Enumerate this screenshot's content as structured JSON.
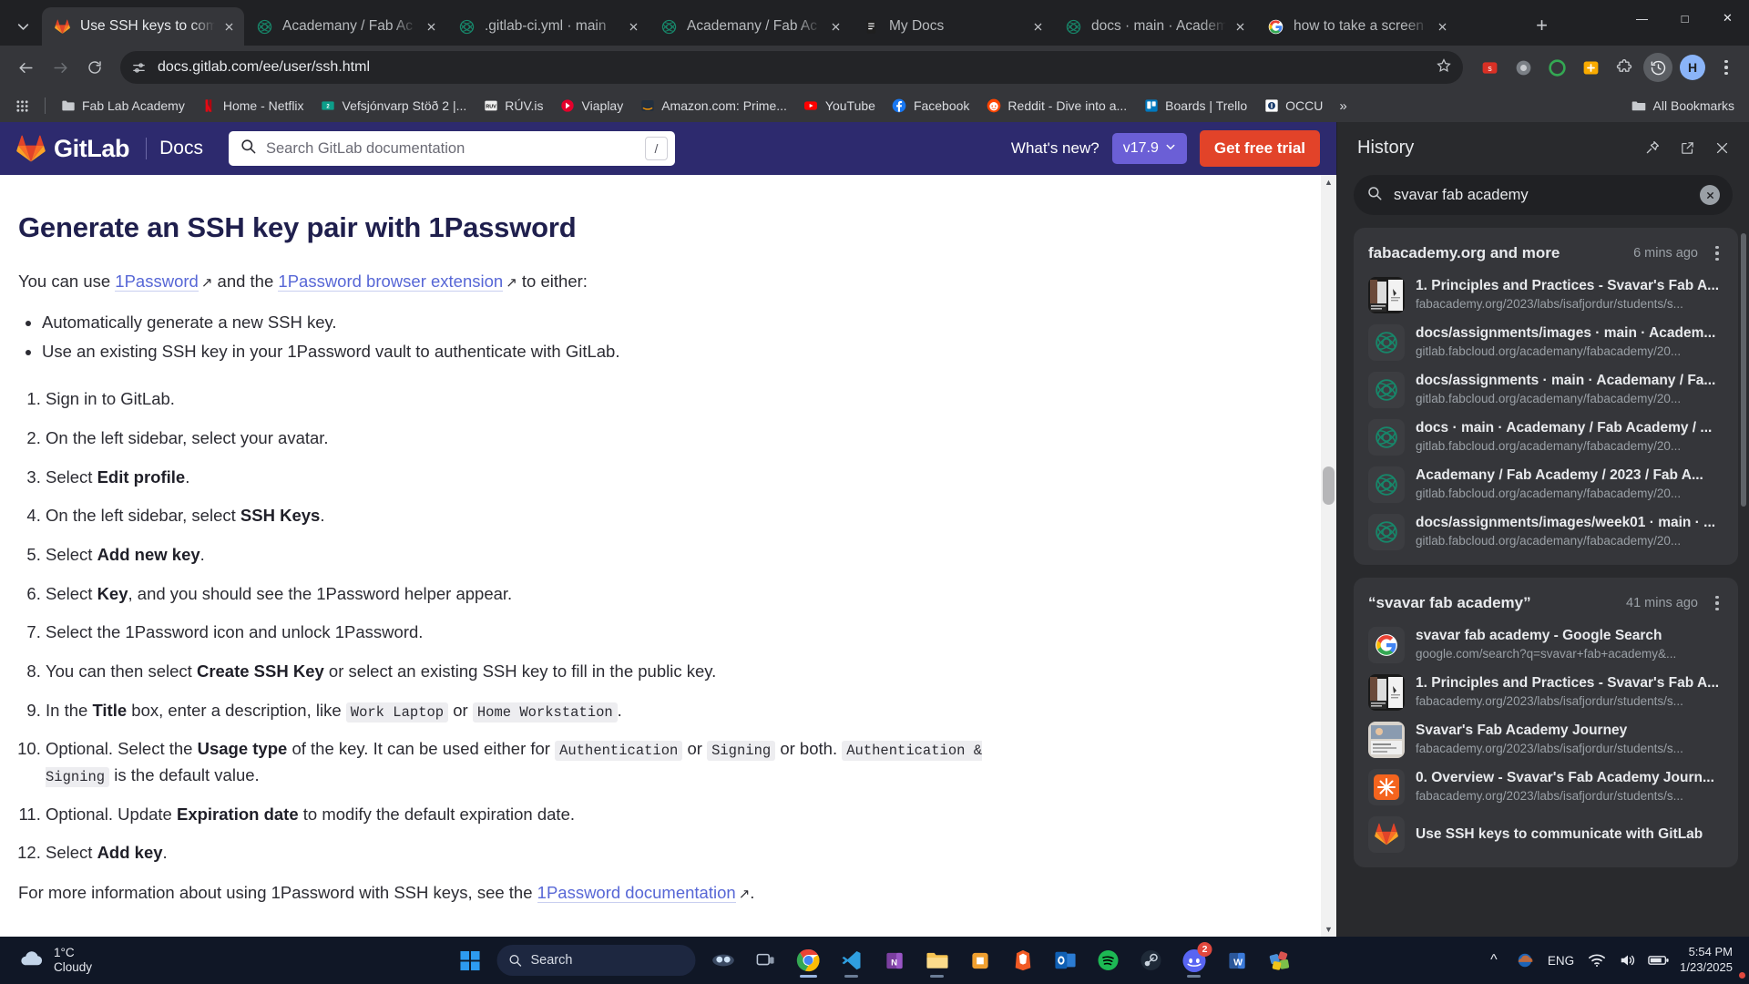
{
  "browser": {
    "tabs": [
      {
        "title": "Use SSH keys to com",
        "favicon": "gitlab-icon",
        "active": true
      },
      {
        "title": "Academany / Fab Ac",
        "favicon": "fabacademy-icon",
        "active": false
      },
      {
        "title": ".gitlab-ci.yml · main",
        "favicon": "fabacademy-icon",
        "active": false
      },
      {
        "title": "Academany / Fab Ac",
        "favicon": "fabacademy-icon",
        "active": false
      },
      {
        "title": "My Docs",
        "favicon": "docs-icon",
        "active": false
      },
      {
        "title": "docs · main · Academ",
        "favicon": "fabacademy-icon",
        "active": false
      },
      {
        "title": "how to take a screen",
        "favicon": "google-icon",
        "active": false
      }
    ],
    "new_tab_label": "+",
    "window_controls": {
      "minimize": "—",
      "maximize": "□",
      "close": "✕"
    },
    "omnibox": {
      "url": "docs.gitlab.com/ee/user/ssh.html",
      "site_icon": "tune-icon",
      "star_icon": "star-icon"
    },
    "profile_initial": "H",
    "bookmarks": [
      {
        "label": "Fab Lab Academy",
        "icon": "folder-icon"
      },
      {
        "label": "Home - Netflix",
        "icon": "netflix-icon"
      },
      {
        "label": "Vefsjónvarp Stöð 2 |...",
        "icon": "stod2-icon"
      },
      {
        "label": "RÚV.is",
        "icon": "ruv-icon"
      },
      {
        "label": "Viaplay",
        "icon": "viaplay-icon"
      },
      {
        "label": "Amazon.com: Prime...",
        "icon": "amazon-icon"
      },
      {
        "label": "YouTube",
        "icon": "youtube-icon"
      },
      {
        "label": "Facebook",
        "icon": "facebook-icon"
      },
      {
        "label": "Reddit - Dive into a...",
        "icon": "reddit-icon"
      },
      {
        "label": "Boards | Trello",
        "icon": "trello-icon"
      },
      {
        "label": "OCCU",
        "icon": "occu-icon"
      }
    ],
    "bookmarks_overflow": "»",
    "all_bookmarks_label": "All Bookmarks"
  },
  "gitlab_header": {
    "brand": "GitLab",
    "docs_label": "Docs",
    "search_placeholder": "Search GitLab documentation",
    "search_shortcut": "/",
    "whats_new": "What's new?",
    "version": "v17.9",
    "trial_button": "Get free trial"
  },
  "page": {
    "title": "Generate an SSH key pair with 1Password",
    "intro": {
      "lead": "You can use ",
      "link1": "1Password",
      "mid": " and the ",
      "link2": "1Password browser extension",
      "tail": " to either:"
    },
    "bullets": [
      "Automatically generate a new SSH key.",
      "Use an existing SSH key in your 1Password vault to authenticate with GitLab."
    ],
    "steps": [
      {
        "n": 1,
        "parts": [
          {
            "t": "Sign in to GitLab."
          }
        ]
      },
      {
        "n": 2,
        "parts": [
          {
            "t": "On the left sidebar, select your avatar."
          }
        ]
      },
      {
        "n": 3,
        "parts": [
          {
            "t": "Select "
          },
          {
            "b": "Edit profile"
          },
          {
            "t": "."
          }
        ]
      },
      {
        "n": 4,
        "parts": [
          {
            "t": "On the left sidebar, select "
          },
          {
            "b": "SSH Keys"
          },
          {
            "t": "."
          }
        ]
      },
      {
        "n": 5,
        "parts": [
          {
            "t": "Select "
          },
          {
            "b": "Add new key"
          },
          {
            "t": "."
          }
        ]
      },
      {
        "n": 6,
        "parts": [
          {
            "t": "Select "
          },
          {
            "b": "Key"
          },
          {
            "t": ", and you should see the 1Password helper appear."
          }
        ]
      },
      {
        "n": 7,
        "parts": [
          {
            "t": "Select the 1Password icon and unlock 1Password."
          }
        ]
      },
      {
        "n": 8,
        "parts": [
          {
            "t": "You can then select "
          },
          {
            "b": "Create SSH Key"
          },
          {
            "t": " or select an existing SSH key to fill in the public key."
          }
        ]
      },
      {
        "n": 9,
        "parts": [
          {
            "t": "In the "
          },
          {
            "b": "Title"
          },
          {
            "t": " box, enter a description, like "
          },
          {
            "c": "Work Laptop"
          },
          {
            "t": " or "
          },
          {
            "c": "Home Workstation"
          },
          {
            "t": "."
          }
        ]
      },
      {
        "n": 10,
        "parts": [
          {
            "t": "Optional. Select the "
          },
          {
            "b": "Usage type"
          },
          {
            "t": " of the key. It can be used either for "
          },
          {
            "c": "Authentication"
          },
          {
            "t": " or "
          },
          {
            "c": "Signing"
          },
          {
            "t": " or both. "
          },
          {
            "c": "Authentication & Signing"
          },
          {
            "t": " is the default value."
          }
        ]
      },
      {
        "n": 11,
        "parts": [
          {
            "t": "Optional. Update "
          },
          {
            "b": "Expiration date"
          },
          {
            "t": " to modify the default expiration date."
          }
        ]
      },
      {
        "n": 12,
        "parts": [
          {
            "t": "Select "
          },
          {
            "b": "Add key"
          },
          {
            "t": "."
          }
        ]
      }
    ],
    "footer": {
      "lead": "For more information about using 1Password with SSH keys, see the ",
      "link": "1Password documentation",
      "tail": "."
    }
  },
  "history_panel": {
    "title": "History",
    "pin_icon": "pin-icon",
    "open_icon": "open-in-new-icon",
    "close_icon": "close-icon",
    "search_value": "svavar fab academy",
    "search_icon": "search-icon",
    "clear_icon": "clear-icon",
    "groups": [
      {
        "title": "fabacademy.org and more",
        "time": "6 mins ago",
        "items": [
          {
            "title": "1. Principles and Practices - Svavar's Fab A...",
            "url": "fabacademy.org/2023/labs/isafjordur/students/s...",
            "icon": "thumbnail"
          },
          {
            "title": "docs/assignments/images · main · Academ...",
            "url": "gitlab.fabcloud.org/academany/fabacademy/20...",
            "icon": "fabacademy-icon"
          },
          {
            "title": "docs/assignments · main · Academany / Fa...",
            "url": "gitlab.fabcloud.org/academany/fabacademy/20...",
            "icon": "fabacademy-icon"
          },
          {
            "title": "docs · main · Academany / Fab Academy / ...",
            "url": "gitlab.fabcloud.org/academany/fabacademy/20...",
            "icon": "fabacademy-icon"
          },
          {
            "title": "Academany / Fab Academy / 2023 / Fab A...",
            "url": "gitlab.fabcloud.org/academany/fabacademy/20...",
            "icon": "fabacademy-icon"
          },
          {
            "title": "docs/assignments/images/week01 · main · ...",
            "url": "gitlab.fabcloud.org/academany/fabacademy/20...",
            "icon": "fabacademy-icon"
          }
        ]
      },
      {
        "title": "“svavar fab academy”",
        "time": "41 mins ago",
        "items": [
          {
            "title": "svavar fab academy - Google Search",
            "url": "google.com/search?q=svavar+fab+academy&...",
            "icon": "google-icon"
          },
          {
            "title": "1. Principles and Practices - Svavar's Fab A...",
            "url": "fabacademy.org/2023/labs/isafjordur/students/s...",
            "icon": "thumbnail"
          },
          {
            "title": "Svavar's Fab Academy Journey",
            "url": "fabacademy.org/2023/labs/isafjordur/students/s...",
            "icon": "thumbnail2"
          },
          {
            "title": "0. Overview - Svavar's Fab Academy Journ...",
            "url": "fabacademy.org/2023/labs/isafjordur/students/s...",
            "icon": "orange-icon"
          },
          {
            "title": "Use SSH keys to communicate with GitLab",
            "url": "",
            "icon": "gitlab-icon"
          }
        ]
      }
    ]
  },
  "taskbar": {
    "weather": {
      "temp": "1°C",
      "condition": "Cloudy",
      "icon": "cloud-icon"
    },
    "start_label": "start-icon",
    "search_placeholder": "Search",
    "apps": [
      {
        "name": "copilot-icon",
        "running": false
      },
      {
        "name": "task-view-icon",
        "running": false
      },
      {
        "name": "chrome-icon",
        "running": true,
        "active": true
      },
      {
        "name": "vscode-icon",
        "running": true
      },
      {
        "name": "onenote-icon",
        "running": false
      },
      {
        "name": "file-explorer-icon",
        "running": true
      },
      {
        "name": "store-icon",
        "running": false
      },
      {
        "name": "brave-icon",
        "running": false
      },
      {
        "name": "outlook-icon",
        "running": false
      },
      {
        "name": "spotify-icon",
        "running": false
      },
      {
        "name": "steam-icon",
        "running": false
      },
      {
        "name": "discord-icon",
        "running": true,
        "badge": "2"
      },
      {
        "name": "word-icon",
        "running": false
      },
      {
        "name": "msi-icon",
        "running": false
      }
    ],
    "tray": {
      "chevron": "^",
      "onedrive_icon": "onedrive-icon",
      "language": "ENG",
      "wifi_icon": "wifi-icon",
      "volume_icon": "volume-icon",
      "battery_icon": "battery-icon",
      "time": "5:54 PM",
      "date": "1/23/2025"
    }
  },
  "colors": {
    "gitlab_purple": "#2d2a6e",
    "gitlab_orange": "#e24329",
    "link_blue": "#5767d6",
    "chrome_dark": "#202124",
    "panel_dark": "#292a2d",
    "taskbar": "#101726"
  }
}
